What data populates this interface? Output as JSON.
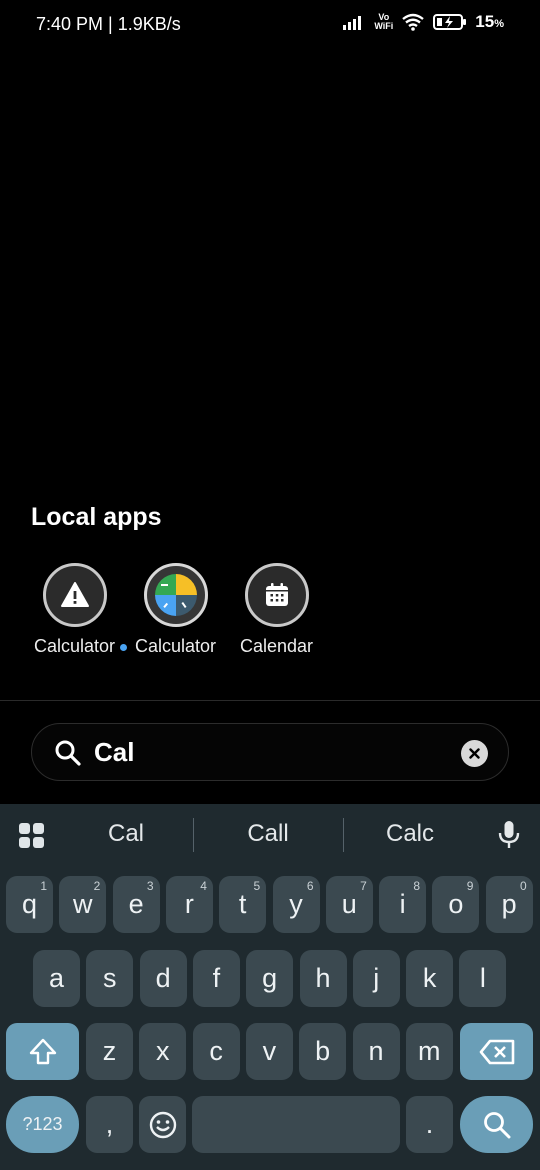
{
  "status": {
    "time": "7:40 PM | 1.9KB/s",
    "vo": "Vo",
    "wifi_label": "WiFi",
    "battery": "15",
    "battery_unit": "%"
  },
  "section": {
    "title": "Local apps"
  },
  "apps": [
    {
      "label": "Calculator",
      "icon": "warning-icon"
    },
    {
      "label": "Calculator",
      "icon": "pie-chart-icon",
      "new_dot": true
    },
    {
      "label": "Calendar",
      "icon": "calendar-icon"
    }
  ],
  "search": {
    "value": "Cal"
  },
  "keyboard": {
    "suggestions": [
      "Cal",
      "Call",
      "Calc"
    ],
    "row1": [
      [
        "q",
        "1"
      ],
      [
        "w",
        "2"
      ],
      [
        "e",
        "3"
      ],
      [
        "r",
        "4"
      ],
      [
        "t",
        "5"
      ],
      [
        "y",
        "6"
      ],
      [
        "u",
        "7"
      ],
      [
        "i",
        "8"
      ],
      [
        "o",
        "9"
      ],
      [
        "p",
        "0"
      ]
    ],
    "row2": [
      "a",
      "s",
      "d",
      "f",
      "g",
      "h",
      "j",
      "k",
      "l"
    ],
    "row3": [
      "z",
      "x",
      "c",
      "v",
      "b",
      "n",
      "m"
    ],
    "symbols_label": "?123",
    "comma": ",",
    "period": "."
  },
  "colors": {
    "accent_dot": "#4aa3f2",
    "keyboard_bg": "#1f2a2f",
    "key_bg": "#3b4950",
    "action_key": "#6a9eb7"
  }
}
